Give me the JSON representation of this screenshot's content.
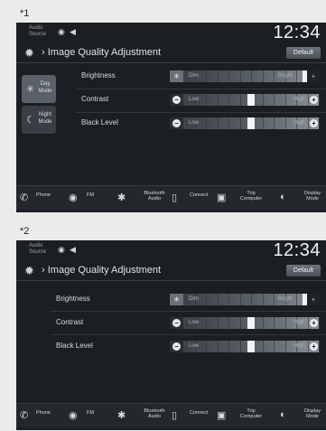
{
  "figures": [
    {
      "label": "*1",
      "status": {
        "audio_source": "Audio Source",
        "time": "12:34"
      },
      "title": "Image Quality Adjustment",
      "default_button": "Default",
      "modes": [
        {
          "label": "Day Mode",
          "icon": "sun-icon",
          "active": true
        },
        {
          "label": "Night Mode",
          "icon": "moon-icon",
          "active": false
        }
      ],
      "rows": [
        {
          "label": "Brightness",
          "low": "Dim",
          "high": "Bright",
          "level": 0.93
        },
        {
          "label": "Contrast",
          "low": "Low",
          "high": "High",
          "level": 0.5
        },
        {
          "label": "Black Level",
          "low": "Low",
          "high": "High",
          "level": 0.5
        }
      ]
    },
    {
      "label": "*2",
      "status": {
        "audio_source": "Audio Source",
        "time": "12:34"
      },
      "title": "Image Quality Adjustment",
      "default_button": "Default",
      "modes": [],
      "rows": [
        {
          "label": "Brightness",
          "low": "Dim",
          "high": "Bright",
          "level": 0.93
        },
        {
          "label": "Contrast",
          "low": "Low",
          "high": "High",
          "level": 0.5
        },
        {
          "label": "Black Level",
          "low": "Low",
          "high": "High",
          "level": 0.5
        }
      ]
    }
  ],
  "nav": [
    {
      "label": "Phone",
      "icon": "phone-icon"
    },
    {
      "label": "FM",
      "icon": "radio-icon"
    },
    {
      "label": "Bluetooth Audio",
      "icon": "bluetooth-icon"
    },
    {
      "label": "Connect",
      "icon": "connect-icon"
    },
    {
      "label": "Trip Computer",
      "icon": "trip-computer-icon"
    },
    {
      "label": "Display Mode",
      "icon": "display-mode-icon"
    }
  ]
}
